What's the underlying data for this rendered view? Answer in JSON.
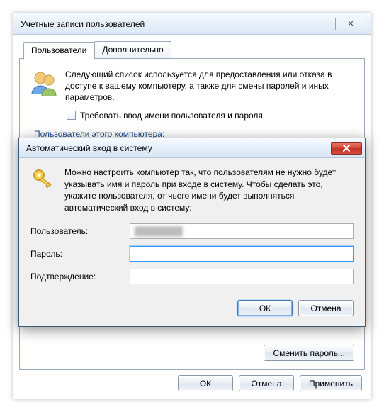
{
  "parent": {
    "title": "Учетные записи пользователей",
    "close_glyph": "✕",
    "tabs": [
      {
        "label": "Пользователи",
        "active": true
      },
      {
        "label": "Дополнительно",
        "active": false
      }
    ],
    "intro": "Следующий список используется для предоставления или отказа в доступе к вашему компьютеру, а также для смены паролей и иных параметров.",
    "require_login_label": "Требовать ввод имени пользователя и пароля.",
    "require_login_checked": false,
    "users_list_label": "Пользователи этого компьютера:",
    "change_password_label": "Сменить пароль...",
    "buttons": {
      "ok": "ОК",
      "cancel": "Отмена",
      "apply": "Применить"
    }
  },
  "modal": {
    "title": "Автоматический вход в систему",
    "intro": "Можно настроить компьютер так, что пользователям не нужно будет указывать имя и пароль при входе в систему. Чтобы сделать это, укажите пользователя, от чьего имени будет выполняться автоматический вход в систему:",
    "fields": {
      "user_label": "Пользователь:",
      "user_value": "",
      "password_label": "Пароль:",
      "password_value": "",
      "confirm_label": "Подтверждение:",
      "confirm_value": ""
    },
    "buttons": {
      "ok": "ОК",
      "cancel": "Отмена"
    }
  },
  "icons": {
    "users": "users-icon",
    "keys": "keys-icon",
    "close": "close-icon"
  }
}
